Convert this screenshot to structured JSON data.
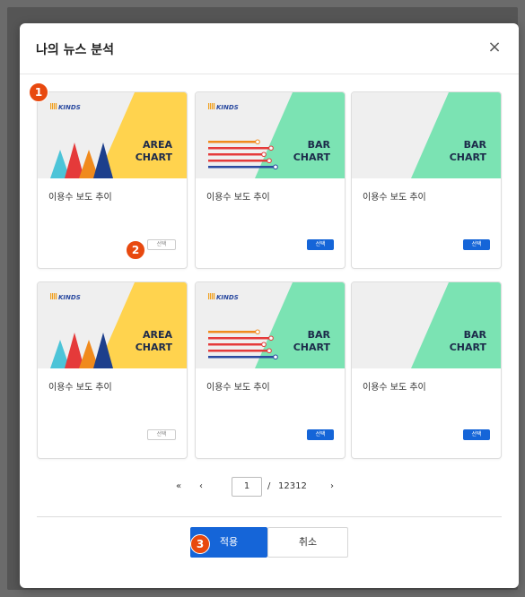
{
  "modal": {
    "title": "나의 뉴스 분석",
    "close_glyph": "×"
  },
  "cards": [
    {
      "chart_label_1": "AREA",
      "chart_label_2": "CHART",
      "title": "이용수 보도 추이",
      "select_label": "선택",
      "select_style": "outline",
      "logo": "KINDS",
      "accent": "#ffd34e"
    },
    {
      "chart_label_1": "BAR",
      "chart_label_2": "CHART",
      "title": "이용수 보도 추이",
      "select_label": "선택",
      "select_style": "primary",
      "logo": "KINDS",
      "accent": "#7be3b3"
    },
    {
      "chart_label_1": "BAR",
      "chart_label_2": "CHART",
      "title": "이용수 보도 추이",
      "select_label": "선택",
      "select_style": "primary",
      "logo": "",
      "accent": "#7be3b3"
    },
    {
      "chart_label_1": "AREA",
      "chart_label_2": "CHART",
      "title": "이용수 보도 추이",
      "select_label": "선택",
      "select_style": "outline",
      "logo": "KINDS",
      "accent": "#ffd34e"
    },
    {
      "chart_label_1": "BAR",
      "chart_label_2": "CHART",
      "title": "이용수 보도 추이",
      "select_label": "선택",
      "select_style": "primary",
      "logo": "KINDS",
      "accent": "#7be3b3"
    },
    {
      "chart_label_1": "BAR",
      "chart_label_2": "CHART",
      "title": "이용수 보도 추이",
      "select_label": "선택",
      "select_style": "primary",
      "logo": "",
      "accent": "#7be3b3"
    }
  ],
  "badges": [
    "1",
    "2",
    "3"
  ],
  "pagination": {
    "first_glyph": "«",
    "prev_glyph": "‹",
    "current_page": "1",
    "separator": "/",
    "total_pages": "12312",
    "next_glyph": "›"
  },
  "footer": {
    "apply_label": "적용",
    "cancel_label": "취소"
  },
  "colors": {
    "primary": "#1565d8",
    "badge": "#e8490f",
    "area_accent": "#ffd34e",
    "bar_accent": "#7be3b3"
  }
}
